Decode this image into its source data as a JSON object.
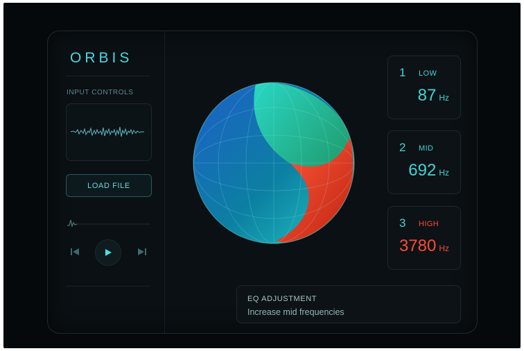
{
  "app": {
    "logo": "ORBIS"
  },
  "sidebar": {
    "section_label": "INPUT CONTROLS",
    "load_button": "LOAD FILE"
  },
  "bands": [
    {
      "index": "1",
      "name": "LOW",
      "value": "87",
      "unit": "Hz",
      "color": "#3fd6d6"
    },
    {
      "index": "2",
      "name": "MID",
      "value": "692",
      "unit": "Hz",
      "color": "#3fd6d6"
    },
    {
      "index": "3",
      "name": "HIGH",
      "value": "3780",
      "unit": "Hz",
      "color": "#ff4a36"
    }
  ],
  "eq": {
    "title": "EQ ADJUSTMENT",
    "text": "Increase mid frequencies"
  },
  "icons": [
    "waveform-icon",
    "skip-back-icon",
    "play-icon",
    "skip-forward-icon"
  ],
  "colors": {
    "accent": "#49d8e0",
    "high": "#ff4a36",
    "background": "#06090c"
  }
}
